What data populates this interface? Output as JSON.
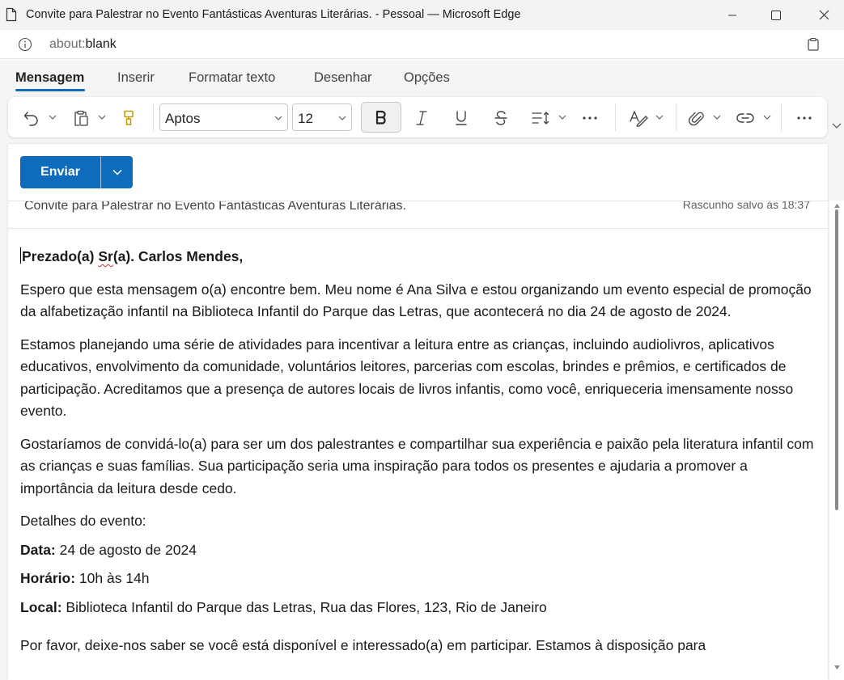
{
  "window": {
    "title": "Convite para Palestrar no Evento Fantásticas Aventuras Literárias. - Pessoal — Microsoft Edge"
  },
  "address": {
    "protocol": "about:",
    "host": "blank"
  },
  "ribbon": {
    "tabs": [
      {
        "label": "Mensagem",
        "active": true
      },
      {
        "label": "Inserir"
      },
      {
        "label": "Formatar texto"
      },
      {
        "label": "Desenhar"
      },
      {
        "label": "Opções"
      }
    ]
  },
  "toolbar": {
    "font": "Aptos",
    "size": "12",
    "icons": [
      "undo-icon",
      "paste-icon",
      "format-painter-icon",
      "bold-icon",
      "italic-icon",
      "underline-icon",
      "strikethrough-icon",
      "line-spacing-icon",
      "more-icon",
      "styles-icon",
      "attach-icon",
      "link-icon",
      "more-options-icon"
    ]
  },
  "compose": {
    "send_label": "Enviar",
    "subject": "Convite para Palestrar no Evento Fantásticas Aventuras Literárias.",
    "draft_status": "Rascunho salvo às 18:37"
  },
  "email": {
    "greeting_pre": "Prezado(a) ",
    "greeting_sr": "Sr",
    "greeting_post": "(a). Carlos Mendes,",
    "p1": "Espero que esta mensagem o(a) encontre bem. Meu nome é Ana Silva e estou organizando um evento especial de promoção da alfabetização infantil na Biblioteca Infantil do Parque das Letras, que acontecerá no dia 24 de agosto de 2024.",
    "p2": "Estamos planejando uma série de atividades para incentivar a leitura entre as crianças, incluindo audiolivros, aplicativos educativos, envolvimento da comunidade, voluntários leitores, parcerias com escolas, brindes e prêmios, e certificados de participação. Acreditamos que a presença de autores locais de livros infantis, como você, enriqueceria imensamente nosso evento.",
    "p3": "Gostaríamos de convidá-lo(a) para ser um dos palestrantes e compartilhar sua experiência e paixão pela literatura infantil com as crianças e suas famílias. Sua participação seria uma inspiração para todos os presentes e ajudaria a promover a importância da leitura desde cedo.",
    "details_heading": "Detalhes do evento:",
    "date_label": "Data:",
    "date_value": " 24 de agosto de 2024",
    "time_label": "Horário:",
    "time_value": " 10h às 14h",
    "place_label": "Local:",
    "place_value": " Biblioteca Infantil do Parque das Letras, Rua das Flores, 123, Rio de Janeiro",
    "p4": "Por favor, deixe-nos saber se você está disponível e interessado(a) em participar. Estamos à disposição para"
  },
  "colors": {
    "accent": "#0f6cbd",
    "spell_error": "#d13438"
  }
}
